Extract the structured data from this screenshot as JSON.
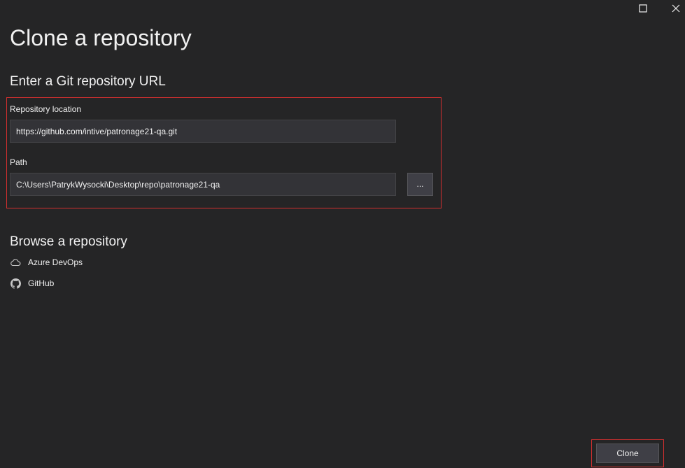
{
  "window": {
    "title": "Clone a repository",
    "maximize_icon": "maximize-icon",
    "close_icon": "close-icon"
  },
  "git_url_section": {
    "heading": "Enter a Git repository URL",
    "repository_location": {
      "label": "Repository location",
      "value": "https://github.com/intive/patronage21-qa.git"
    },
    "path": {
      "label": "Path",
      "value": "C:\\Users\\PatrykWysocki\\Desktop\\repo\\patronage21-qa",
      "browse_label": "..."
    }
  },
  "browse_section": {
    "heading": "Browse a repository",
    "items": [
      {
        "label": "Azure DevOps",
        "icon": "cloud-icon"
      },
      {
        "label": "GitHub",
        "icon": "github-icon"
      }
    ]
  },
  "footer": {
    "clone_label": "Clone"
  },
  "colors": {
    "background": "#252526",
    "highlight_border": "#d32f2f",
    "input_background": "#333337",
    "button_background": "#3f3f46",
    "text": "#f1f1f1"
  }
}
